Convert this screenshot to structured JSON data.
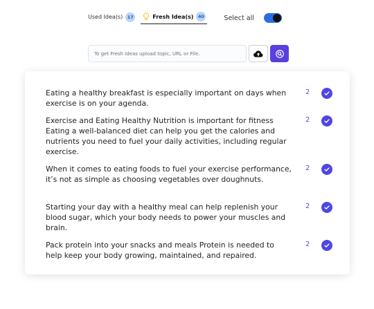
{
  "tabs": {
    "used": {
      "label": "Used Idea(s)",
      "count": "17"
    },
    "fresh": {
      "label": "Fresh Idea(s)",
      "count": "40"
    },
    "select_all_label": "Select all",
    "select_all_on": true
  },
  "search": {
    "placeholder": "To get Fresh Ideas upload topic, URL or File.",
    "value": ""
  },
  "icons": {
    "bulb": "lightbulb-icon",
    "upload": "cloud-upload-icon",
    "search": "search-icon",
    "check": "check-circle-icon"
  },
  "colors": {
    "accent": "#4f46e5",
    "toggle": "#2b6de8",
    "badge": "#b9d6f7",
    "bulb": "#f5c518"
  },
  "ideas": [
    {
      "text": "Eating a healthy breakfast is especially important on days when exercise is on your agenda.",
      "count": "2",
      "selected": true
    },
    {
      "text": "Exercise and Eating Healthy Nutrition is important for fitness Eating a well-balanced diet can help you get the calories and nutrients you need to fuel your daily activities, including regular exercise.",
      "count": "2",
      "selected": true
    },
    {
      "text": "When it comes to eating foods to fuel your exercise performance, it’s not as simple as choosing vegetables over doughnuts.",
      "count": "2",
      "selected": true
    },
    {
      "text": "Starting your day with a healthy meal can help replenish your blood sugar, which your body needs to power your muscles and brain.",
      "count": "2",
      "selected": true
    },
    {
      "text": "Pack protein into your snacks and meals Protein is needed to help keep your body growing, maintained, and repaired.",
      "count": "2",
      "selected": true
    }
  ]
}
